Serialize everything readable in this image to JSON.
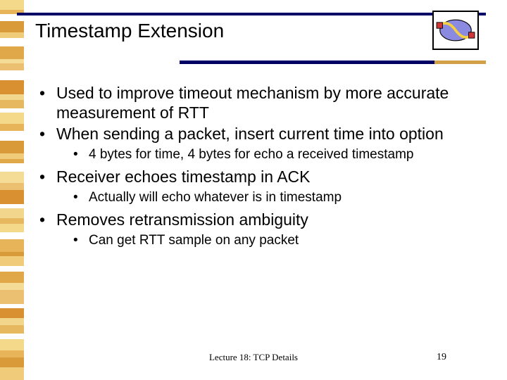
{
  "slide": {
    "title": "Timestamp Extension",
    "bullets": {
      "b0": "Used to improve timeout mechanism by more accurate measurement of RTT",
      "b1": "When sending a packet, insert current time into option",
      "b1a": "4 bytes for time, 4 bytes for echo a received timestamp",
      "b2": "Receiver echoes timestamp in ACK",
      "b2a": "Actually will echo whatever is in timestamp",
      "b3": "Removes retransmission ambiguity",
      "b3a": "Can get RTT sample on any packet"
    },
    "footer": "Lecture 18: TCP Details",
    "page_number": "19"
  },
  "decor": {
    "logo_name": "cloud-network-icon",
    "stripe_colors": [
      "#f5d98a",
      "#e8b45a",
      "#d99a3a",
      "#f0cc7a",
      "#e0a848",
      "#f5dc96",
      "#ebc070",
      "#d89030",
      "#f2d68c",
      "#e6b860"
    ]
  }
}
